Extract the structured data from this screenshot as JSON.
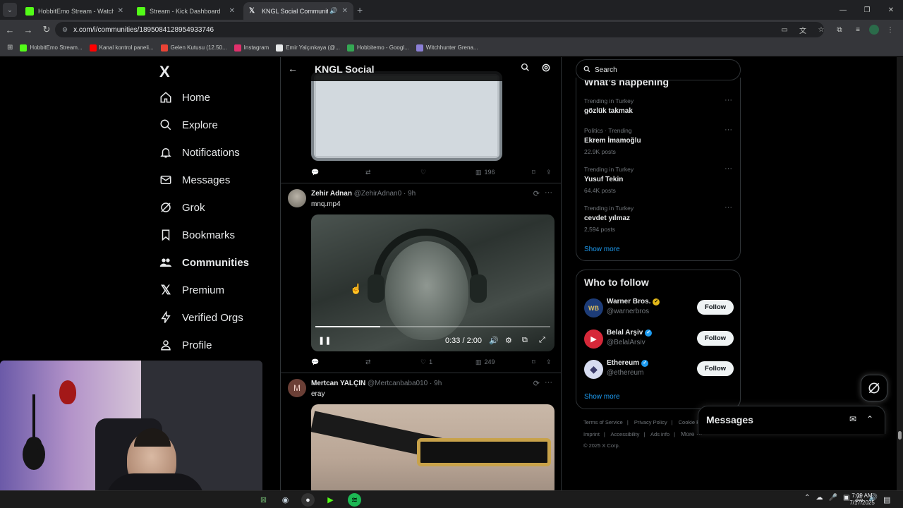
{
  "browser": {
    "tabs": [
      {
        "label": "HobbitEmo Stream - Watch Liv",
        "favicon_color": "#53fc18",
        "active": false
      },
      {
        "label": "Stream - Kick Dashboard",
        "favicon_color": "#53fc18",
        "active": false
      },
      {
        "label": "KNGL Social Community / X",
        "favicon_color": "#e7e9ea",
        "active": true
      }
    ],
    "url": "x.com/i/communities/1895084128954933746",
    "bookmarks": [
      {
        "label": "HobbitEmo Stream...",
        "color": "#53fc18"
      },
      {
        "label": "Kanal kontrol paneli...",
        "color": "#ff0000"
      },
      {
        "label": "Gelen Kutusu (12.50...",
        "color": "#ea4335"
      },
      {
        "label": "Instagram",
        "color": "#e1306c"
      },
      {
        "label": "Emir Yalçınkaya (@...",
        "color": "#e7e9ea"
      },
      {
        "label": "Hobbitemo - Googl...",
        "color": "#34a853"
      },
      {
        "label": "Witchhunter Grena...",
        "color": "#8b7fd6"
      }
    ]
  },
  "nav": {
    "logo": "X",
    "items": [
      {
        "label": "Home",
        "icon": "home-icon"
      },
      {
        "label": "Explore",
        "icon": "search-icon"
      },
      {
        "label": "Notifications",
        "icon": "bell-icon"
      },
      {
        "label": "Messages",
        "icon": "envelope-icon"
      },
      {
        "label": "Grok",
        "icon": "grok-icon"
      },
      {
        "label": "Bookmarks",
        "icon": "bookmark-icon"
      },
      {
        "label": "Communities",
        "icon": "people-icon"
      },
      {
        "label": "Premium",
        "icon": "x-icon"
      },
      {
        "label": "Verified Orgs",
        "icon": "lightning-icon"
      },
      {
        "label": "Profile",
        "icon": "person-icon"
      }
    ]
  },
  "community": {
    "title": "KNGL Social"
  },
  "posts": [
    {
      "actions": {
        "replies": "",
        "reposts": "",
        "likes": "",
        "views": "196"
      }
    },
    {
      "name": "Zehir Adnan",
      "handle": "@ZehirAdnan0",
      "time": "9h",
      "text": "mnq.mp4",
      "video": {
        "time": "0:33 / 2:00",
        "progress": 0.275
      },
      "actions": {
        "replies": "",
        "reposts": "",
        "likes": "1",
        "views": "249"
      }
    },
    {
      "name": "Mertcan YALÇIN",
      "handle": "@Mertcanbaba010",
      "time": "9h",
      "avatar_letter": "M",
      "text": "eray"
    }
  ],
  "sidebar": {
    "search_placeholder": "Search",
    "trends_title": "What’s happening",
    "trends": [
      {
        "meta": "Trending in Turkey",
        "title": "gözlük takmak",
        "posts": ""
      },
      {
        "meta": "Politics · Trending",
        "title": "Ekrem İmamoğlu",
        "posts": "22.9K posts"
      },
      {
        "meta": "Trending in Turkey",
        "title": "Yusuf Tekin",
        "posts": "64.4K posts"
      },
      {
        "meta": "Trending in Turkey",
        "title": "cevdet yılmaz",
        "posts": "2,594 posts"
      }
    ],
    "show_more": "Show more",
    "who_to_follow_title": "Who to follow",
    "follow": [
      {
        "name": "Warner Bros.",
        "handle": "@warnerbros",
        "badge": "gold",
        "avatar_color": "#1d3c78"
      },
      {
        "name": "Belal Arşiv",
        "handle": "@BelalArsiv",
        "badge": "blue",
        "avatar_color": "#d62839"
      },
      {
        "name": "Ethereum",
        "handle": "@ethereum",
        "badge": "blue",
        "avatar_color": "#d7dcf0"
      }
    ],
    "follow_label": "Follow",
    "footer": [
      "Terms of Service",
      "|",
      "Privacy Policy",
      "|",
      "Cookie Policy",
      "|",
      "Imprint",
      "|",
      "Accessibility",
      "|",
      "Ads info",
      "|",
      "More ···",
      "© 2025 X Corp."
    ]
  },
  "messages_drawer": {
    "title": "Messages"
  },
  "taskbar": {
    "time": "7:09 AM",
    "date": "7/17/2025"
  }
}
